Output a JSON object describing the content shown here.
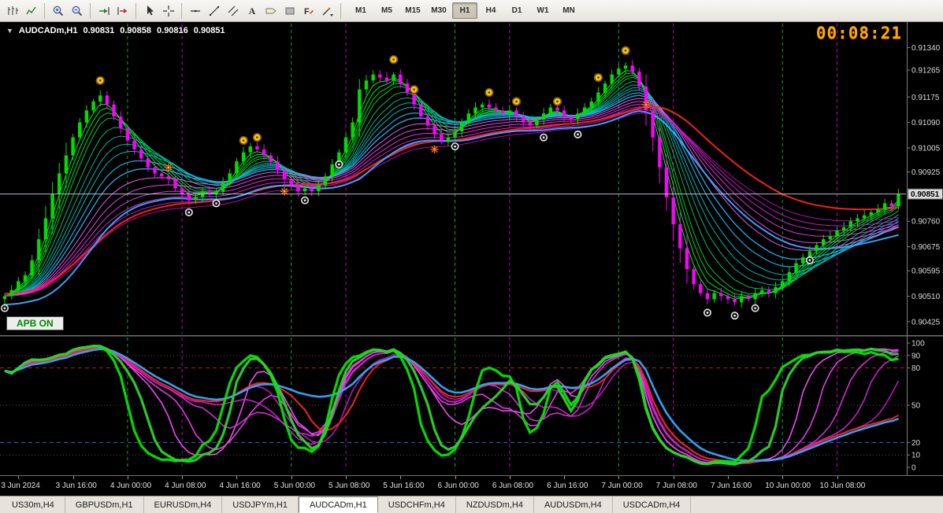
{
  "toolbar": {
    "icon_buttons": [
      "bar-chart",
      "line-chart",
      "zoom-in",
      "zoom-out",
      "auto-scroll",
      "chart-shift",
      "cursor",
      "crosshair",
      "horizontal-line",
      "trendline",
      "equidistant-channel",
      "text",
      "text-label",
      "shapes",
      "arrows",
      "draw-tools"
    ],
    "timeframes": [
      {
        "label": "M1",
        "active": false
      },
      {
        "label": "M5",
        "active": false
      },
      {
        "label": "M15",
        "active": false
      },
      {
        "label": "M30",
        "active": false
      },
      {
        "label": "H1",
        "active": true
      },
      {
        "label": "H4",
        "active": false
      },
      {
        "label": "D1",
        "active": false
      },
      {
        "label": "W1",
        "active": false
      },
      {
        "label": "MN",
        "active": false
      }
    ]
  },
  "chart": {
    "header": {
      "dropdown": "▼",
      "symbol": "AUDCADm,H1",
      "open": "0.90831",
      "high": "0.90858",
      "low": "0.90816",
      "close": "0.90851"
    },
    "timer": "00:08:21",
    "apb_button": "APB ON",
    "price_axis": {
      "top": 0.9142,
      "bottom": 0.90385,
      "labels": [
        "0.91340",
        "0.91265",
        "0.91175",
        "0.91090",
        "0.91005",
        "0.90925",
        "0.90760",
        "0.90675",
        "0.90595",
        "0.90510",
        "0.90425"
      ],
      "current": "0.90851"
    },
    "colors": {
      "up": "#00dd00",
      "down": "#ff00ff",
      "price_line": "#c4ccdc",
      "separator_day": "#00cc44",
      "separator_mid": "#e800e8",
      "timer": "#ffaa00",
      "background": "#000000"
    }
  },
  "chart_data": {
    "type": "candlestick",
    "symbol": "AUDCADm",
    "timeframe": "H1",
    "open_first": 0.905,
    "closes": [
      0.9051,
      0.9053,
      0.9056,
      0.9058,
      0.9063,
      0.907,
      0.9077,
      0.9085,
      0.9092,
      0.9098,
      0.9104,
      0.9109,
      0.9113,
      0.9116,
      0.9118,
      0.9115,
      0.9111,
      0.9107,
      0.9103,
      0.91,
      0.9097,
      0.9094,
      0.9092,
      0.9091,
      0.909,
      0.9087,
      0.9085,
      0.9083,
      0.9084,
      0.9086,
      0.9085,
      0.9086,
      0.9089,
      0.9092,
      0.9096,
      0.9099,
      0.9101,
      0.91,
      0.9098,
      0.9096,
      0.9093,
      0.909,
      0.9088,
      0.9086,
      0.9087,
      0.9086,
      0.9088,
      0.9091,
      0.9095,
      0.9099,
      0.9104,
      0.9109,
      0.912,
      0.9123,
      0.9125,
      0.9124,
      0.9123,
      0.9125,
      0.9122,
      0.9119,
      0.9115,
      0.9111,
      0.9108,
      0.9105,
      0.9103,
      0.9104,
      0.9106,
      0.9109,
      0.9112,
      0.9114,
      0.9115,
      0.9114,
      0.9113,
      0.9112,
      0.9113,
      0.9111,
      0.9109,
      0.9108,
      0.911,
      0.9112,
      0.9114,
      0.9113,
      0.9111,
      0.911,
      0.9112,
      0.9114,
      0.9116,
      0.9119,
      0.9122,
      0.9125,
      0.9127,
      0.9128,
      0.9126,
      0.9121,
      0.9113,
      0.9104,
      0.9094,
      0.9084,
      0.9075,
      0.9067,
      0.906,
      0.9055,
      0.9052,
      0.905,
      0.9052,
      0.9051,
      0.905,
      0.9049,
      0.9051,
      0.905,
      0.9052,
      0.9053,
      0.9052,
      0.9054,
      0.9056,
      0.9059,
      0.9062,
      0.9064,
      0.9066,
      0.9068,
      0.907,
      0.9071,
      0.9073,
      0.9074,
      0.9076,
      0.9077,
      0.9078,
      0.9079,
      0.908,
      0.9082,
      0.9081,
      0.90851
    ],
    "ribbons": [
      {
        "period": 3,
        "color": "#00ff33",
        "width": 1
      },
      {
        "period": 4,
        "color": "#00f02c",
        "width": 1
      },
      {
        "period": 5,
        "color": "#00e226",
        "width": 1
      },
      {
        "period": 6,
        "color": "#00d43d",
        "width": 1
      },
      {
        "period": 8,
        "color": "#00c76a",
        "width": 1
      },
      {
        "period": 10,
        "color": "#00bd96",
        "width": 1
      },
      {
        "period": 12,
        "color": "#00c0b4",
        "width": 1
      },
      {
        "period": 14,
        "color": "#00c4cc",
        "width": 1
      },
      {
        "period": 17,
        "color": "#18b4e0",
        "width": 1.2
      },
      {
        "period": 20,
        "color": "#2fa8e8",
        "width": 1.4
      },
      {
        "period": 24,
        "color": "#ff5aff",
        "width": 1
      },
      {
        "period": 28,
        "color": "#f648f6",
        "width": 1
      },
      {
        "period": 32,
        "color": "#ea36ea",
        "width": 1
      },
      {
        "period": 36,
        "color": "#dc26dc",
        "width": 1
      },
      {
        "period": 40,
        "color": "#cc18cc",
        "width": 1
      },
      {
        "period": 45,
        "color": "#bb0cbb",
        "width": 1
      },
      {
        "period": 48,
        "color": "#ff2222",
        "width": 2,
        "source": "high"
      },
      {
        "period": 30,
        "color": "#3fa9ff",
        "width": 2,
        "source": "low"
      }
    ],
    "markers": [
      {
        "bar": 0,
        "price": 0.9047,
        "type": "exit"
      },
      {
        "bar": 14,
        "price": 0.9123,
        "type": "sell"
      },
      {
        "bar": 24,
        "price": 0.9094,
        "type": "star"
      },
      {
        "bar": 27,
        "price": 0.9079,
        "type": "exit"
      },
      {
        "bar": 31,
        "price": 0.9082,
        "type": "exit"
      },
      {
        "bar": 35,
        "price": 0.9103,
        "type": "sell"
      },
      {
        "bar": 37,
        "price": 0.9104,
        "type": "sell"
      },
      {
        "bar": 41,
        "price": 0.9086,
        "type": "star"
      },
      {
        "bar": 44,
        "price": 0.9083,
        "type": "exit"
      },
      {
        "bar": 49,
        "price": 0.9095,
        "type": "exit"
      },
      {
        "bar": 57,
        "price": 0.913,
        "type": "sell"
      },
      {
        "bar": 60,
        "price": 0.912,
        "type": "sell"
      },
      {
        "bar": 63,
        "price": 0.91,
        "type": "star"
      },
      {
        "bar": 66,
        "price": 0.9101,
        "type": "exit"
      },
      {
        "bar": 71,
        "price": 0.9119,
        "type": "sell"
      },
      {
        "bar": 75,
        "price": 0.9116,
        "type": "sell"
      },
      {
        "bar": 79,
        "price": 0.9104,
        "type": "exit"
      },
      {
        "bar": 81,
        "price": 0.9116,
        "type": "sell"
      },
      {
        "bar": 84,
        "price": 0.9105,
        "type": "exit"
      },
      {
        "bar": 87,
        "price": 0.9124,
        "type": "sell"
      },
      {
        "bar": 91,
        "price": 0.9133,
        "type": "sell"
      },
      {
        "bar": 94,
        "price": 0.9115,
        "type": "star"
      },
      {
        "bar": 103,
        "price": 0.90455,
        "type": "exit"
      },
      {
        "bar": 107,
        "price": 0.90445,
        "type": "exit"
      },
      {
        "bar": 110,
        "price": 0.9047,
        "type": "exit"
      },
      {
        "bar": 118,
        "price": 0.9063,
        "type": "exit"
      }
    ]
  },
  "indicator": {
    "scale_labels": [
      "100",
      "90",
      "80",
      "50",
      "20",
      "10",
      "0"
    ],
    "levels": [
      {
        "value": 90,
        "color": "#4d4d4d",
        "dash": "1,3",
        "width": 1
      },
      {
        "value": 80,
        "color": "#b22222",
        "dash": "5,4",
        "width": 1
      },
      {
        "value": 50,
        "color": "#4d4d4d",
        "dash": "1,3",
        "width": 1
      },
      {
        "value": 20,
        "color": "#2e6bc4",
        "dash": "5,4",
        "width": 1
      },
      {
        "value": 10,
        "color": "#4d4d4d",
        "dash": "1,3",
        "width": 1
      }
    ],
    "lines": [
      {
        "period": 17,
        "smooth": 4,
        "color": "#ff4dff",
        "width": 1.6
      },
      {
        "period": 21,
        "smooth": 4,
        "color": "#f23df2",
        "width": 1.6
      },
      {
        "period": 25,
        "smooth": 5,
        "color": "#e32ee3",
        "width": 1.6
      },
      {
        "period": 29,
        "smooth": 5,
        "color": "#d421d4",
        "width": 1.6
      },
      {
        "period": 33,
        "smooth": 6,
        "color": "#c414c4",
        "width": 1.6
      },
      {
        "period": 38,
        "smooth": 6,
        "color": "#ff2222",
        "width": 2
      },
      {
        "period": 46,
        "smooth": 8,
        "color": "#33aaff",
        "width": 2.6
      },
      {
        "period": 9,
        "smooth": 3,
        "color": "#00e800",
        "width": 3.2
      },
      {
        "period": 13,
        "smooth": 3,
        "color": "#2bd42b",
        "width": 3.2
      }
    ]
  },
  "time_axis": {
    "labels": [
      "3 Jun 2024",
      "3 Jun 16:00",
      "4 Jun 00:00",
      "4 Jun 08:00",
      "4 Jun 16:00",
      "5 Jun 00:00",
      "5 Jun 08:00",
      "5 Jun 16:00",
      "6 Jun 00:00",
      "6 Jun 08:00",
      "6 Jun 16:00",
      "7 Jun 00:00",
      "7 Jun 08:00",
      "7 Jun 16:00",
      "10 Jun 00:00",
      "10 Jun 08:00"
    ]
  },
  "tabs": [
    {
      "label": "US30m,H4",
      "active": false
    },
    {
      "label": "GBPUSDm,H1",
      "active": false
    },
    {
      "label": "EURUSDm,H4",
      "active": false
    },
    {
      "label": "USDJPYm,H1",
      "active": false
    },
    {
      "label": "AUDCADm,H1",
      "active": true
    },
    {
      "label": "USDCHFm,H4",
      "active": false
    },
    {
      "label": "NZDUSDm,H4",
      "active": false
    },
    {
      "label": "AUDUSDm,H4",
      "active": false
    },
    {
      "label": "USDCADm,H4",
      "active": false
    }
  ]
}
